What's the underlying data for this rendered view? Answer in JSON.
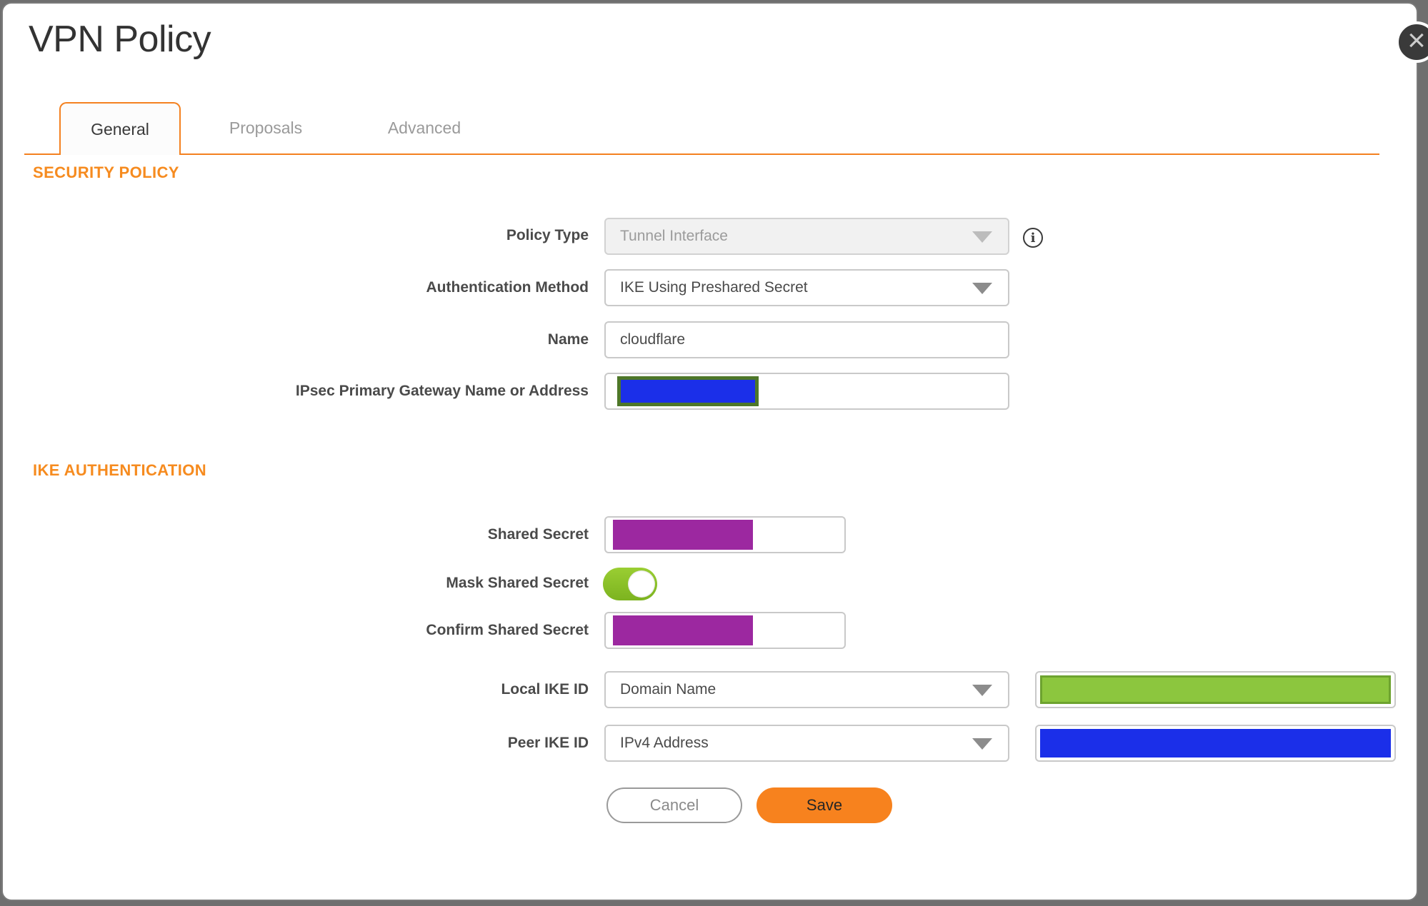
{
  "header": {
    "title": "VPN Policy"
  },
  "icons": {
    "close": "×",
    "info": "i"
  },
  "tabs": {
    "general": "General",
    "proposals": "Proposals",
    "advanced": "Advanced"
  },
  "security_policy": {
    "heading": "SECURITY POLICY",
    "policy_type": {
      "label": "Policy Type",
      "value": "Tunnel Interface",
      "disabled": true
    },
    "auth_method": {
      "label": "Authentication Method",
      "value": "IKE Using Preshared Secret"
    },
    "name": {
      "label": "Name",
      "value": "cloudflare"
    },
    "gateway": {
      "label": "IPsec Primary Gateway Name or Address",
      "value": "",
      "redacted": true
    }
  },
  "ike_authentication": {
    "heading": "IKE AUTHENTICATION",
    "shared_secret": {
      "label": "Shared Secret",
      "redacted": true
    },
    "mask_shared_secret": {
      "label": "Mask Shared Secret",
      "state": "on"
    },
    "confirm_shared_secret": {
      "label": "Confirm Shared Secret",
      "redacted": true
    },
    "local_ike_id": {
      "label": "Local IKE ID",
      "value": "Domain Name",
      "side_value_redacted": true
    },
    "peer_ike_id": {
      "label": "Peer IKE ID",
      "value": "IPv4 Address",
      "side_value_redacted": true
    }
  },
  "footer": {
    "cancel": "Cancel",
    "save": "Save"
  },
  "colors": {
    "accent_orange": "#F48120",
    "heading_orange": "#F68B1F",
    "save_orange": "#F7821E",
    "toggle_green": "#87C32A",
    "redaction_purple": "#9C28A0",
    "redaction_blue": "#1B2FE9",
    "redaction_green_fill": "#8CC63E",
    "redaction_green_border": "#6DA32F",
    "redaction_olive_border": "#4E7729",
    "backdrop_gray": "#6F6F6F"
  }
}
